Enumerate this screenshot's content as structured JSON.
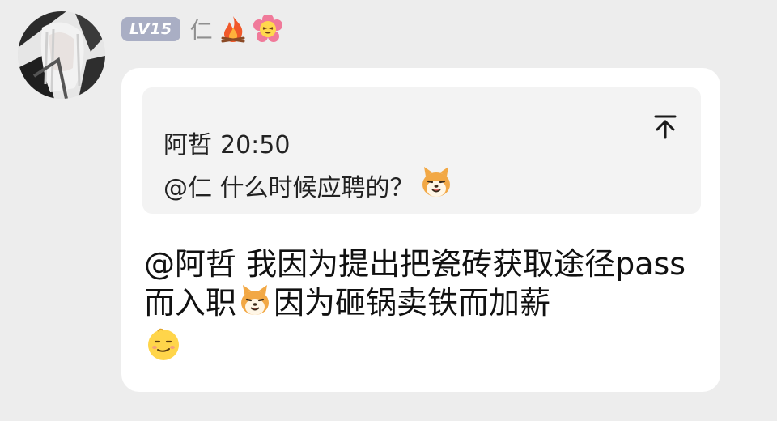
{
  "sender": {
    "level_badge": "LV15",
    "nickname": "仁",
    "badge_icons": [
      "fire-icon",
      "flower-face-icon"
    ]
  },
  "quote": {
    "author": "阿哲",
    "time": "20:50",
    "text": "@仁 什么时候应聘的？",
    "emoji": "shiba-dog-emoji",
    "jump_icon": "jump-to-top-icon"
  },
  "message": {
    "segment_1": "@阿哲 我因为提出把瓷砖获取途径pass而入职",
    "emoji_1": "shiba-dog-emoji",
    "segment_2": "因为砸锅卖铁而加薪",
    "emoji_2": "smile-face-emoji"
  },
  "colors": {
    "background": "#ededed",
    "bubble": "#ffffff",
    "quote_box": "#f3f3f3",
    "level_badge": "#a9aec4",
    "nickname": "#8f8f8f"
  }
}
